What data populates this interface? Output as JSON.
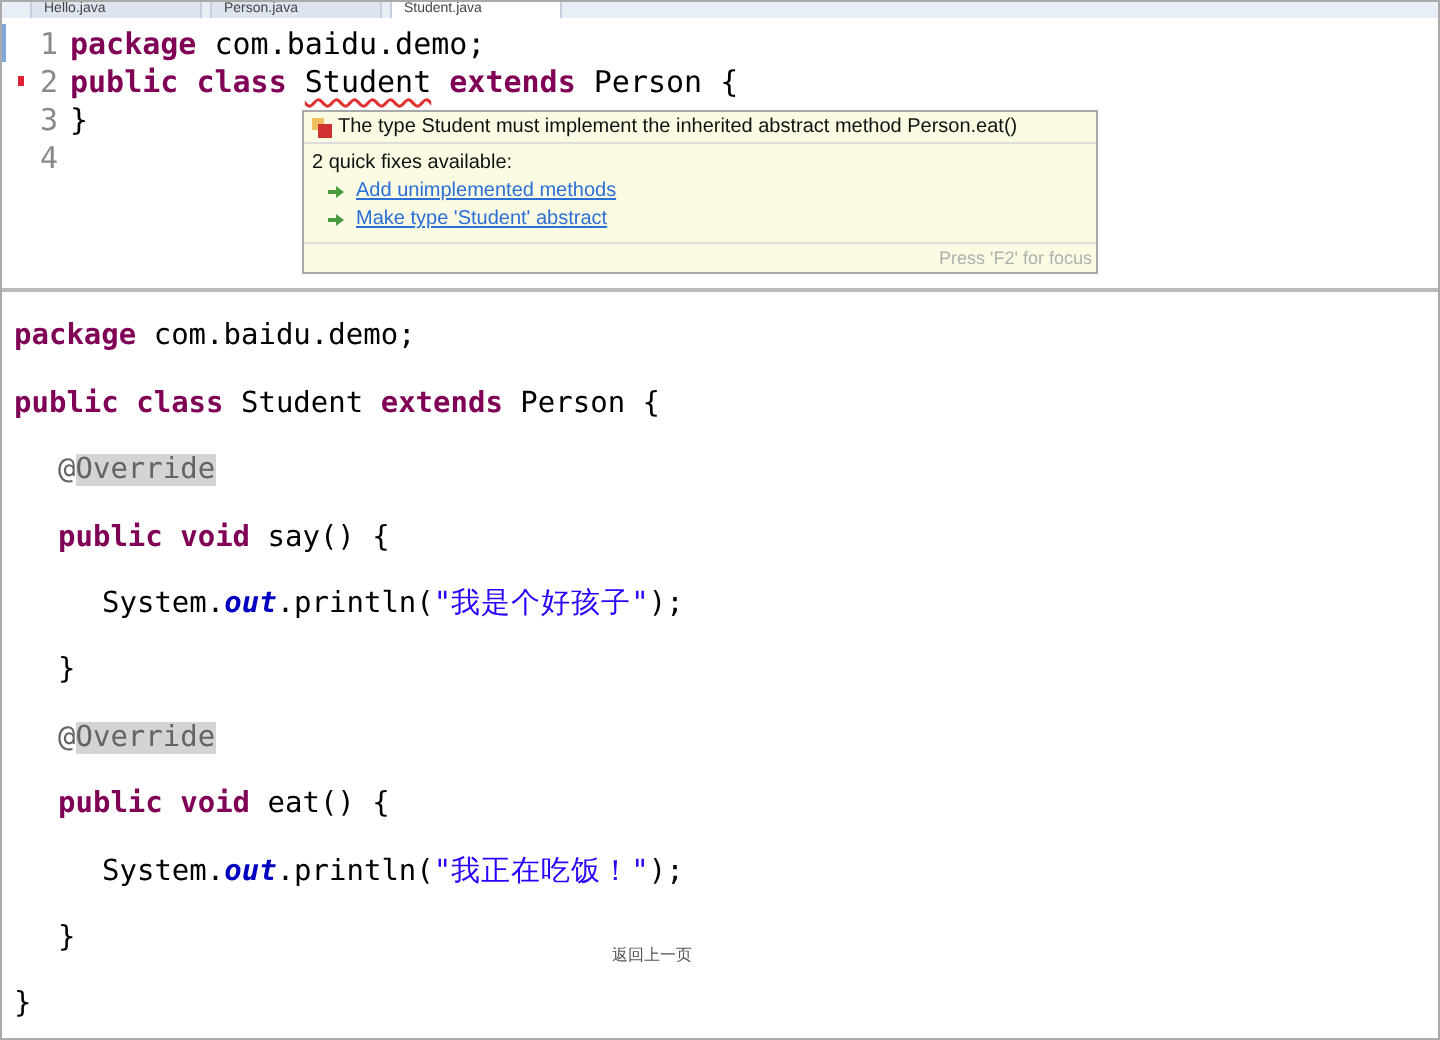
{
  "editor": {
    "tabs": [
      {
        "label": "Hello.java",
        "selected": false
      },
      {
        "label": "Person.java",
        "selected": false
      },
      {
        "label": "Student.java",
        "selected": true
      }
    ],
    "lines": [
      {
        "number": "1",
        "current": true,
        "error": false,
        "tokens": [
          {
            "kind": "keyword",
            "text": "package"
          },
          {
            "kind": "plain",
            "text": " com.baidu.demo;"
          }
        ]
      },
      {
        "number": "2",
        "current": false,
        "error": true,
        "tokens": [
          {
            "kind": "keyword",
            "text": "public class "
          },
          {
            "kind": "plain",
            "text": "Student",
            "error": true
          },
          {
            "kind": "keyword",
            "text": " extends"
          },
          {
            "kind": "plain",
            "text": " Person {"
          }
        ]
      },
      {
        "number": "3",
        "current": false,
        "error": false,
        "tokens": [
          {
            "kind": "plain",
            "text": "}"
          }
        ]
      },
      {
        "number": "4",
        "current": false,
        "error": false
      }
    ],
    "hover": {
      "problem": "The type Student must implement the inherited abstract method Person.eat()",
      "summary": "2 quick fixes available:",
      "fixes": [
        "Add unimplemented methods",
        "Make type 'Student' abstract"
      ],
      "footer": "Press 'F2' for focus"
    }
  },
  "code": [
    {
      "tokens": [
        {
          "kind": "keyword",
          "text": "package"
        },
        {
          "kind": "plain",
          "text": " com.baidu.demo;"
        }
      ]
    },
    {
      "tokens": [
        {
          "kind": "keyword",
          "text": "public class"
        },
        {
          "kind": "plain",
          "text": " Student "
        },
        {
          "kind": "keyword",
          "text": "extends"
        },
        {
          "kind": "plain",
          "text": " Person {"
        }
      ],
      "children": [
        {
          "tokens": [
            {
              "kind": "annotation",
              "text": "@"
            },
            {
              "kind": "annotation",
              "text": "Override",
              "highlighted": true
            }
          ]
        },
        {
          "tokens": [
            {
              "kind": "keyword",
              "text": "public void"
            },
            {
              "kind": "plain",
              "text": " say() {"
            }
          ],
          "children": [
            {
              "tokens": [
                {
                  "kind": "plain",
                  "text": "System."
                },
                {
                  "kind": "static",
                  "text": "out"
                },
                {
                  "kind": "plain",
                  "text": ".println("
                },
                {
                  "kind": "string",
                  "text": "\"我是个好孩子\""
                },
                {
                  "kind": "plain",
                  "text": ");"
                }
              ]
            }
          ]
        },
        {
          "tokens": [
            {
              "kind": "plain",
              "text": "}"
            }
          ]
        },
        {
          "tokens": [
            {
              "kind": "annotation",
              "text": "@"
            },
            {
              "kind": "annotation",
              "text": "Override",
              "highlighted": true
            }
          ]
        },
        {
          "tokens": [
            {
              "kind": "keyword",
              "text": "public void"
            },
            {
              "kind": "plain",
              "text": " eat() {"
            }
          ],
          "children": [
            {
              "tokens": [
                {
                  "kind": "plain",
                  "text": "System."
                },
                {
                  "kind": "static",
                  "text": "out"
                },
                {
                  "kind": "plain",
                  "text": ".println("
                },
                {
                  "kind": "string",
                  "text": "\"我正在吃饭！\""
                },
                {
                  "kind": "plain",
                  "text": ");"
                }
              ]
            }
          ]
        },
        {
          "tokens": [
            {
              "kind": "plain",
              "text": "}"
            }
          ]
        }
      ]
    },
    {
      "tokens": [
        {
          "kind": "plain",
          "text": "}"
        }
      ]
    }
  ],
  "back_link": "返回上一页"
}
